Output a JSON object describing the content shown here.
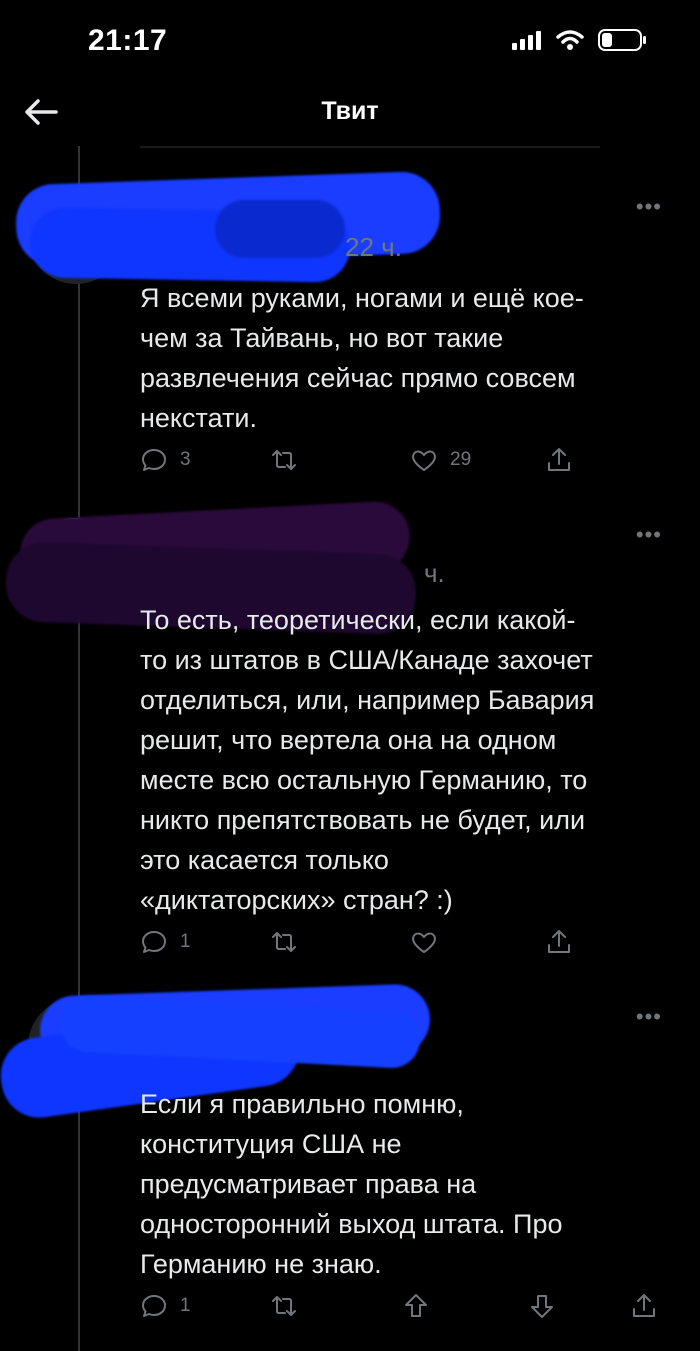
{
  "status_bar": {
    "time": "21:17"
  },
  "header": {
    "title": "Твит"
  },
  "tweets": [
    {
      "time_fragment": "22 ч.",
      "text": "Я всеми руками, ногами и ещё кое-\nчем за Тайвань, но вот такие\nразвлечения сейчас прямо совсем\nнекстати.",
      "reply_count": "3",
      "like_count": "29"
    },
    {
      "time_fragment": "ч.",
      "text": "То есть, теоретически, если какой-\nто из штатов в США/Канаде захочет\nотделиться, или, например Бавария\nрешит, что вертела она на одном\nместе всю остальную Германию, то\nникто препятствовать не будет, или\nэто касается только\n«диктаторских» стран? :)",
      "reply_count": "1",
      "like_count": ""
    },
    {
      "time_fragment": "",
      "text": "Если я правильно помню,\nконституция США не\nпредусматривает права на\nодносторонний выход штата. Про\nГерманию не знаю.",
      "reply_count": "1",
      "like_count": ""
    }
  ],
  "colors": {
    "background": "#000000",
    "text": "#e7e9ea",
    "muted": "#71767b",
    "redaction_blue": "#1140ff",
    "redaction_purple": "#2a0a3a"
  },
  "icons": [
    "back-arrow-icon",
    "signal-icon",
    "wifi-icon",
    "battery-icon",
    "more-icon",
    "reply-icon",
    "retweet-icon",
    "like-icon",
    "share-icon",
    "upvote-icon",
    "downvote-icon"
  ]
}
